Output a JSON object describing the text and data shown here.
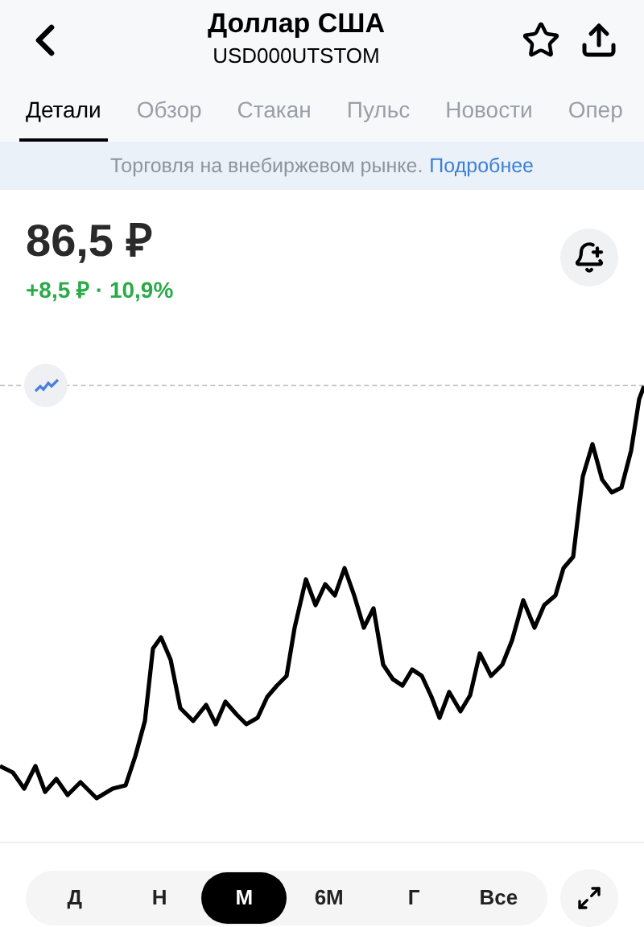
{
  "header": {
    "title": "Доллар США",
    "ticker": "USD000UTSTOM"
  },
  "tabs": [
    {
      "label": "Детали",
      "selected": true
    },
    {
      "label": "Обзор",
      "selected": false
    },
    {
      "label": "Стакан",
      "selected": false
    },
    {
      "label": "Пульс",
      "selected": false
    },
    {
      "label": "Новости",
      "selected": false
    },
    {
      "label": "Опер",
      "selected": false
    }
  ],
  "banner": {
    "text": "Торговля на внебиржевом рынке.",
    "link": "Подробнее"
  },
  "price": {
    "value": "86,5 ₽",
    "change": "+8,5 ₽ · 10,9%"
  },
  "periods": [
    {
      "label": "Д",
      "selected": false
    },
    {
      "label": "Н",
      "selected": false
    },
    {
      "label": "М",
      "selected": true
    },
    {
      "label": "6М",
      "selected": false
    },
    {
      "label": "Г",
      "selected": false
    },
    {
      "label": "Все",
      "selected": false
    }
  ]
}
